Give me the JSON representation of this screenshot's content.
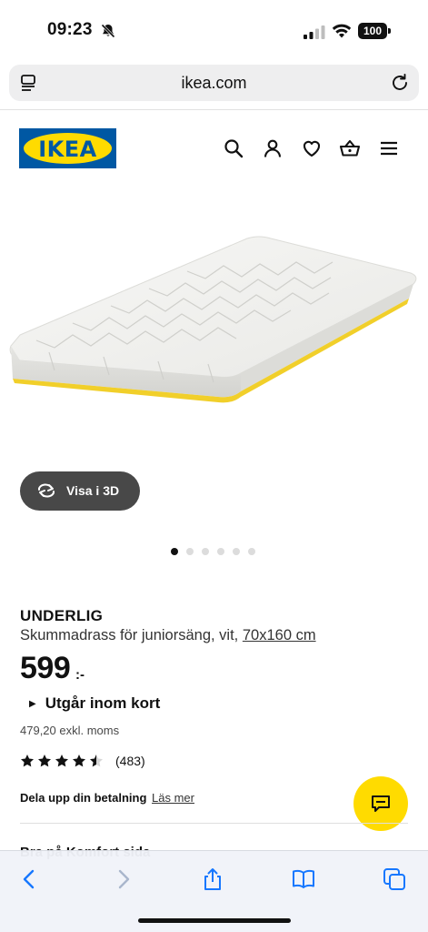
{
  "status_bar": {
    "time": "09:23",
    "battery": "100"
  },
  "browser": {
    "url": "ikea.com"
  },
  "header": {
    "logo_text": "IKEA",
    "brand_colors": {
      "blue": "#0058a3",
      "yellow": "#ffdb00"
    },
    "icons": [
      "search-icon",
      "account-icon",
      "wishlist-heart-icon",
      "basket-icon",
      "menu-icon"
    ]
  },
  "gallery": {
    "view_3d_label": "Visa i 3D",
    "image_count": 6,
    "active_index": 0
  },
  "product": {
    "name": "UNDERLIG",
    "description": "Skummadrass för juniorsäng, vit,",
    "size": "70x160 cm",
    "price": "599",
    "price_suffix": ":-",
    "availability": "Utgår inom kort",
    "price_excl_vat": "479,20 exkl. moms",
    "rating": 4.5,
    "review_count": "(483)",
    "payment_label": "Dela upp din betalning",
    "payment_link": "Läs mer",
    "partial_section_title": "Bra på Komfort sida"
  },
  "toolbar": {
    "icons": [
      "back-icon",
      "forward-icon",
      "share-icon",
      "bookmarks-icon",
      "tabs-icon"
    ]
  }
}
